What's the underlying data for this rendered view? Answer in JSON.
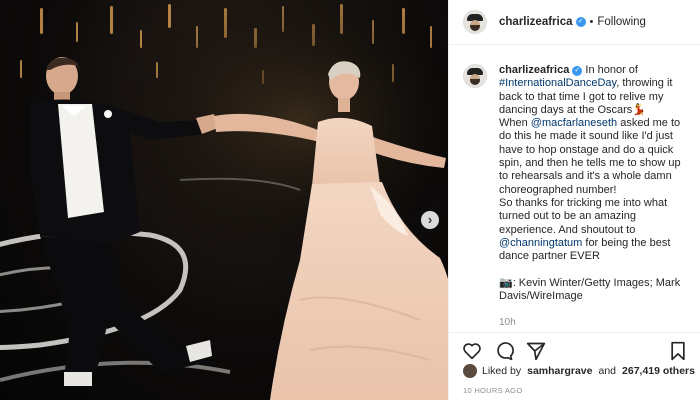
{
  "post": {
    "username": "charlizeafrica",
    "follow_state": "Following",
    "separator": "•",
    "verified_mark": "✓",
    "carousel_next": "›"
  },
  "caption": {
    "username": "charlizeafrica",
    "t1": " In honor of ",
    "l1": "#InternationalDanceDay",
    "t2": ", throwing it back to that time I got to relive my dancing days at the Oscars💃\nWhen ",
    "l2": "@macfarlaneseth",
    "t3": " asked me to do this he made it sound like I'd just have to hop onstage and do a quick spin, and then he tells me to show up to rehearsals and it's a whole damn choreographed number!\nSo thanks for tricking me into what turned out to be an amazing experience. And shoutout to ",
    "l3": "@channingtatum",
    "t4": " for being the best dance partner EVER\n\n📷: Kevin Winter/Getty Images; Mark Davis/WireImage",
    "age": "10h"
  },
  "actions": {
    "like_icon": "heart-outline",
    "comment_icon": "speech-bubble",
    "share_icon": "paper-plane",
    "save_icon": "bookmark"
  },
  "likes": {
    "prefix": "Liked by",
    "user": "samhargrave",
    "joiner": "and",
    "count": "267,419 others"
  },
  "time_ago": "10 HOURS AGO"
}
